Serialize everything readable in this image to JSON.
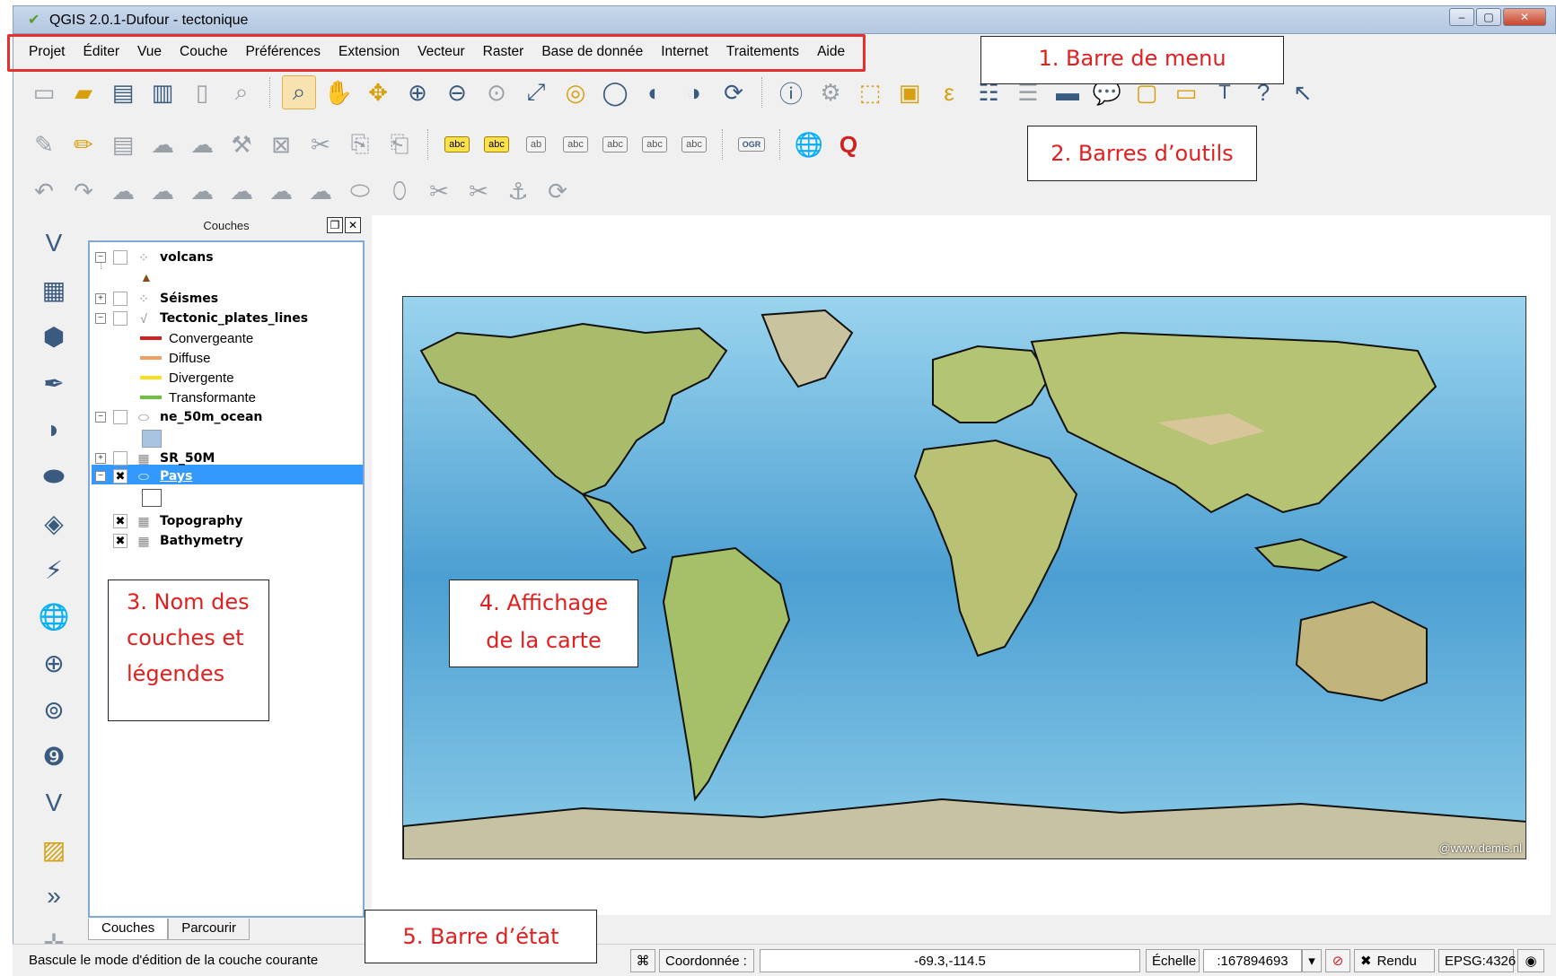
{
  "window": {
    "title": "QGIS 2.0.1-Dufour - tectonique",
    "buttons": [
      "–",
      "▢",
      "✕"
    ]
  },
  "menu": [
    "Projet",
    "Éditer",
    "Vue",
    "Couche",
    "Préférences",
    "Extension",
    "Vecteur",
    "Raster",
    "Base de donnée",
    "Internet",
    "Traitements",
    "Aide"
  ],
  "toolbar_icons": {
    "row1": [
      "new-project-icon",
      "open-project-icon",
      "save-project-icon",
      "save-as-icon",
      "new-print-composer-icon",
      "composer-manager-icon",
      "pan-map-to-selection-icon",
      "pan-icon",
      "pan-selection-icon",
      "zoom-in-icon",
      "zoom-out-icon",
      "zoom-actual-size-icon",
      "zoom-full-icon",
      "zoom-selection-icon",
      "zoom-layer-icon",
      "zoom-last-icon",
      "zoom-next-icon",
      "refresh-icon",
      "identify-icon",
      "run-action-icon",
      "select-icon",
      "deselect-icon",
      "open-attribute-table-icon",
      "measure-icon",
      "map-tips-icon",
      "new-bookmark-icon",
      "show-bookmarks-icon",
      "text-annotation-icon",
      "help-icon",
      "whats-this-icon"
    ],
    "row2_labels": [
      "abc",
      "abc",
      "ab",
      "abc",
      "abc",
      "abc",
      "abc"
    ],
    "row2_ogr": "OGR"
  },
  "layers_panel": {
    "title": "Couches",
    "layers": [
      {
        "name": "volcans",
        "checked": false
      },
      {
        "name": "Séismes",
        "checked": false
      },
      {
        "name": "Tectonic_plates_lines",
        "checked": false
      },
      {
        "name": "ne_50m_ocean",
        "checked": false
      },
      {
        "name": "SR_50M",
        "checked": false
      },
      {
        "name": "Pays",
        "checked": true,
        "selected": true
      },
      {
        "name": "Topography",
        "checked": true
      },
      {
        "name": "Bathymetry",
        "checked": true
      }
    ],
    "legend_tectonic": [
      {
        "label": "Convergeante",
        "color": "#d02020"
      },
      {
        "label": "Diffuse",
        "color": "#f0a060"
      },
      {
        "label": "Divergente",
        "color": "#f8e020"
      },
      {
        "label": "Transformante",
        "color": "#70c040"
      }
    ],
    "check_mark": "✖",
    "tabs": [
      "Couches",
      "Parcourir"
    ]
  },
  "annotations": {
    "a1": "1.    Barre de menu",
    "a2": "2. Barres d’outils",
    "a3_lines": [
      "3. Nom des",
      "couches et",
      "légendes"
    ],
    "a4_lines": [
      "4. Affichage",
      "de la carte"
    ],
    "a5": "5. Barre d’état"
  },
  "map": {
    "credit": "@www.demis.nl",
    "colors": {
      "ocean": "#6ab8e0",
      "ocean_deep": "#3f8fc8",
      "land": "#b8c67a",
      "land_high": "#d8c69a",
      "border": "#111111"
    }
  },
  "status": {
    "message": "Bascule le mode d'édition de la couche courante",
    "coord_label": "Coordonnée :",
    "coord_value": "-69.3,-114.5",
    "scale_label": "Échelle",
    "scale_value": ":167894693",
    "render_label": "Rendu",
    "epsg": "EPSG:4326"
  }
}
